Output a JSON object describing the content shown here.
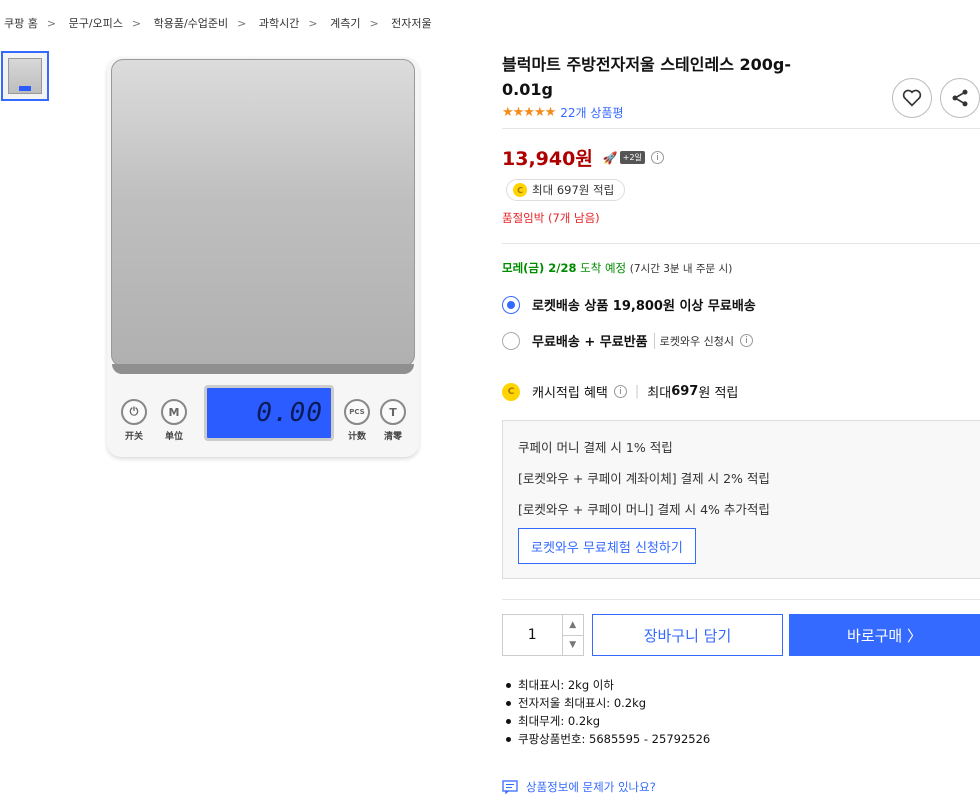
{
  "breadcrumb": [
    "쿠팡 홈",
    "문구/오피스",
    "학용품/수업준비",
    "과학시간",
    "계측기",
    "전자저울"
  ],
  "breadcrumb_sep": ">",
  "product_image": {
    "lcd_reading": "0.00",
    "buttons": [
      {
        "icon": "power-icon",
        "glyph": "⏻",
        "label": "开关"
      },
      {
        "icon": "m-icon",
        "glyph": "M",
        "label": "单位"
      },
      {
        "icon": "pcs-icon",
        "glyph": "PCS",
        "label": "计数"
      },
      {
        "icon": "t-icon",
        "glyph": "T",
        "label": "清零"
      }
    ]
  },
  "product": {
    "title": "블럭마트 주방전자저울 스테인레스 200g-0.01g",
    "stars": "★★★★★",
    "rating": 4.5,
    "review_count": "22개 상품평"
  },
  "price": {
    "value": "13,940원",
    "rocket_badge": "+2일",
    "cash_text": "최대 697원 적립",
    "stock_text": "품절임박 (7개 남음)"
  },
  "delivery": {
    "date": "모레(금) 2/28",
    "suffix": "도착 예정",
    "condition": "(7시간 3분 내 주문 시)"
  },
  "options": [
    {
      "bold": "로켓배송 상품 19,800원 이상 무료배송",
      "sub": "",
      "selected": true
    },
    {
      "bold": "무료배송 + 무료반품",
      "sub": "로켓와우 신청시",
      "selected": false
    }
  ],
  "cash_benefit": {
    "label": "캐시적립 혜택",
    "value_prefix": "최대 ",
    "value": "697",
    "value_suffix": "원 적립"
  },
  "promo": {
    "lines": [
      "쿠페이 머니 결제 시 1% 적립",
      "[로켓와우 + 쿠페이 계좌이체] 결제 시 2% 적립",
      "[로켓와우 + 쿠페이 머니] 결제 시 4% 추가적립"
    ],
    "button": "로켓와우 무료체험 신청하기"
  },
  "purchase": {
    "quantity": "1",
    "cart_label": "장바구니 담기",
    "buy_label": "바로구매 〉"
  },
  "specs": [
    "최대표시: 2kg 이하",
    "전자저울 최대표시: 0.2kg",
    "최대무게: 0.2kg",
    "쿠팡상품번호: 5685595 - 25792526"
  ],
  "report_label": "상품정보에 문제가 있나요?",
  "colors": {
    "accent": "#346aff",
    "price": "#ae0000",
    "stock": "#e52528",
    "delivery": "#008c00",
    "star": "#f38c1a"
  }
}
